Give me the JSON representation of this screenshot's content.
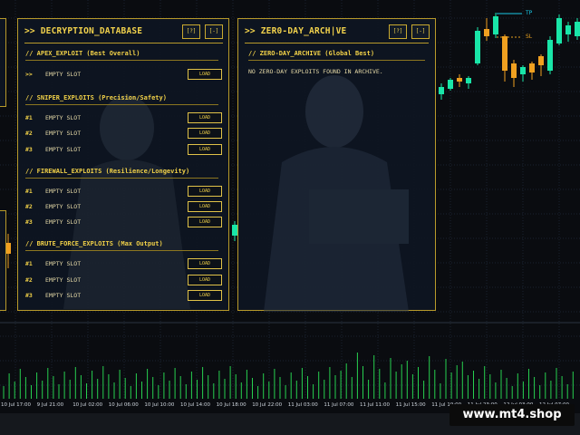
{
  "chart": {
    "tp_label": "TP",
    "sl_label": "SL",
    "time_labels": [
      "10 Jul 17:00",
      "9 Jul 21:00",
      "10 Jul 02:00",
      "10 Jul 06:00",
      "10 Jul 10:00",
      "10 Jul 14:00",
      "10 Jul 18:00",
      "10 Jul 22:00",
      "11 Jul 03:00",
      "11 Jul 07:00",
      "11 Jul 11:00",
      "11 Jul 15:00",
      "11 Jul 19:00",
      "11 Jul 23:00",
      "12 Jul 03:00",
      "12 Jul 07:00"
    ],
    "colors": {
      "bull": "#19e6a8",
      "bear": "#f0a020",
      "volume": "#27d050",
      "tp": "#19c8e6",
      "sl": "#e6a020",
      "grid": "#1a2230"
    }
  },
  "decryption_panel": {
    "title": ">> DECRYPTION_DATABASE",
    "help_button": "[?]",
    "minimize_button": "[-]",
    "sections": [
      {
        "title": "// APEX_EXPLOIT (Best Overall)",
        "slots": [
          {
            "rank": ">>",
            "label": "EMPTY SLOT",
            "button": "LOAD"
          }
        ]
      },
      {
        "title": "// SNIPER_EXPLOITS (Precision/Safety)",
        "slots": [
          {
            "rank": "#1",
            "label": "EMPTY SLOT",
            "button": "LOAD"
          },
          {
            "rank": "#2",
            "label": "EMPTY SLOT",
            "button": "LOAD"
          },
          {
            "rank": "#3",
            "label": "EMPTY SLOT",
            "button": "LOAD"
          }
        ]
      },
      {
        "title": "// FIREWALL_EXPLOITS (Resilience/Longevity)",
        "slots": [
          {
            "rank": "#1",
            "label": "EMPTY SLOT",
            "button": "LOAD"
          },
          {
            "rank": "#2",
            "label": "EMPTY SLOT",
            "button": "LOAD"
          },
          {
            "rank": "#3",
            "label": "EMPTY SLOT",
            "button": "LOAD"
          }
        ]
      },
      {
        "title": "// BRUTE_FORCE_EXPLOITS (Max Output)",
        "slots": [
          {
            "rank": "#1",
            "label": "EMPTY SLOT",
            "button": "LOAD"
          },
          {
            "rank": "#2",
            "label": "EMPTY SLOT",
            "button": "LOAD"
          },
          {
            "rank": "#3",
            "label": "EMPTY SLOT",
            "button": "LOAD"
          }
        ]
      }
    ]
  },
  "zero_day_panel": {
    "title": ">> ZER0-DAY_ARCH|VE",
    "help_button": "[?]",
    "minimize_button": "[-]",
    "section_title": "// ZERO-DAY_ARCHIVE (Global Best)",
    "message": "NO ZERO-DAY EXPLOITS FOUND IN ARCHIVE."
  },
  "watermark": "www.mt4.shop"
}
